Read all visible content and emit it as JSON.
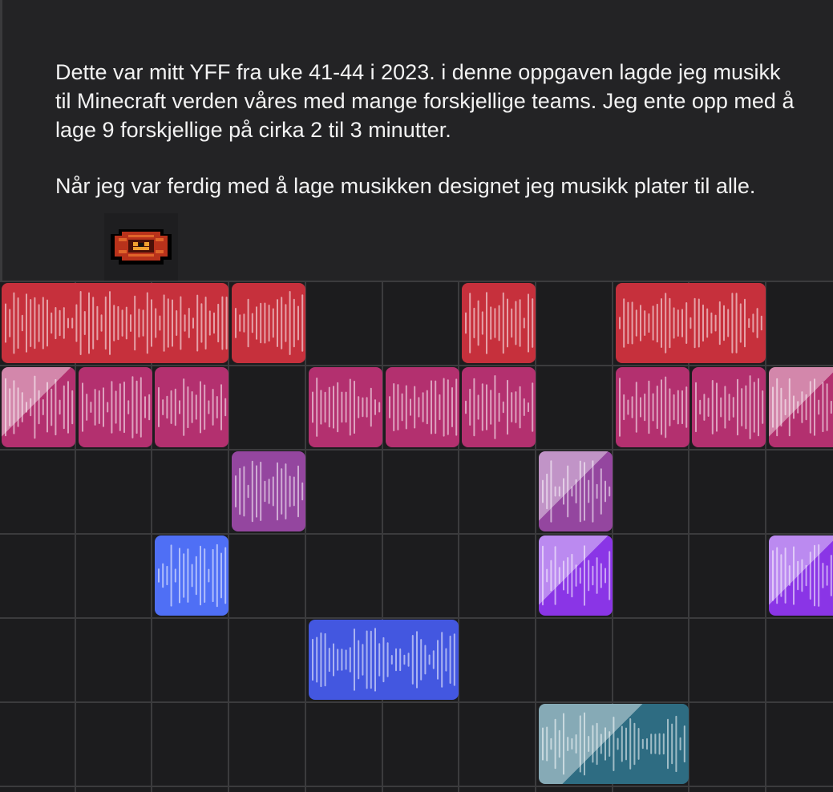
{
  "description": {
    "paragraphs": [
      "Dette var mitt YFF fra uke 41-44 i 2023. i denne oppgaven lagde jeg musikk til Minecraft verden våres med mange forskjellige teams. Jeg ente opp med å lage 9 forskjellige på cirka 2 til 3 minutter.",
      "Når jeg var ferdig med å lage musikken designet jeg musikk plater til alle."
    ]
  },
  "icons": {
    "record": "music-disc-icon"
  },
  "colors": {
    "background": "#232325",
    "grid_bg": "#1c1c1e",
    "grid_line": "#3b3b3d",
    "text": "#f2f2f2",
    "row1": "#c6303c",
    "row2": "#b3306f",
    "row3": "#94469f",
    "row4a": "#4f6ff5",
    "row4b": "#8a35e6",
    "row5": "#4357e0",
    "row6": "#2e6c82"
  },
  "tracks": [
    {
      "name": "track-1",
      "color": "#c6303c",
      "clips": [
        {
          "start": 0,
          "span": 3,
          "playing": false
        },
        {
          "start": 3,
          "span": 1,
          "playing": false
        },
        {
          "start": 6,
          "span": 1,
          "playing": false
        },
        {
          "start": 8,
          "span": 2,
          "playing": false
        }
      ]
    },
    {
      "name": "track-2",
      "color": "#b3306f",
      "clips": [
        {
          "start": 0,
          "span": 1,
          "playing": true
        },
        {
          "start": 1,
          "span": 1,
          "playing": false
        },
        {
          "start": 2,
          "span": 1,
          "playing": false
        },
        {
          "start": 4,
          "span": 1,
          "playing": false
        },
        {
          "start": 5,
          "span": 1,
          "playing": false
        },
        {
          "start": 6,
          "span": 1,
          "playing": false
        },
        {
          "start": 8,
          "span": 1,
          "playing": false
        },
        {
          "start": 9,
          "span": 1,
          "playing": false
        },
        {
          "start": 10,
          "span": 1,
          "playing": true
        }
      ]
    },
    {
      "name": "track-3",
      "color": "#94469f",
      "clips": [
        {
          "start": 3,
          "span": 1,
          "playing": false
        },
        {
          "start": 7,
          "span": 1,
          "playing": true
        }
      ]
    },
    {
      "name": "track-4",
      "color": "#4f6ff5",
      "clips": [
        {
          "start": 2,
          "span": 1,
          "playing": false,
          "color": "#4f6ff5"
        },
        {
          "start": 7,
          "span": 1,
          "playing": true,
          "color": "#8a35e6"
        },
        {
          "start": 10,
          "span": 1,
          "playing": true,
          "color": "#8a35e6"
        }
      ]
    },
    {
      "name": "track-5",
      "color": "#4357e0",
      "clips": [
        {
          "start": 4,
          "span": 2,
          "playing": false
        }
      ]
    },
    {
      "name": "track-6",
      "color": "#2e6c82",
      "clips": [
        {
          "start": 7,
          "span": 2,
          "playing": true
        }
      ]
    }
  ]
}
